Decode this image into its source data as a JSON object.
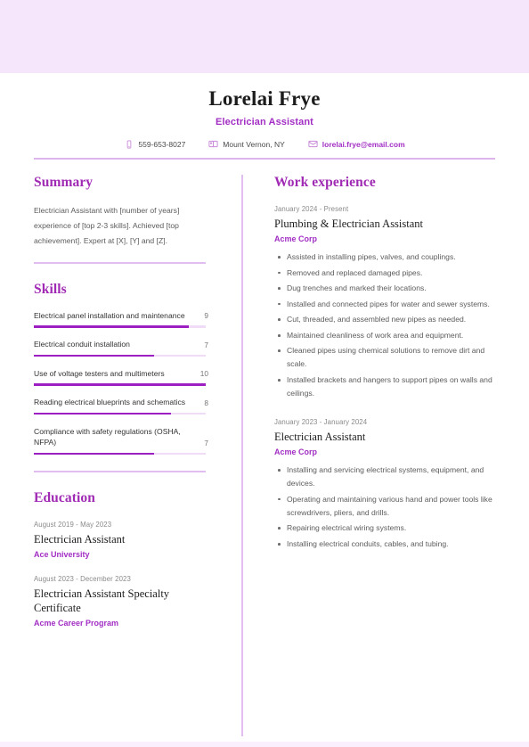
{
  "theme": {
    "accent": "#a22ec4",
    "accent_bar": "#9b1fc1",
    "band": "#f6e6fb",
    "rule": "#e2bdf0"
  },
  "header": {
    "name": "Lorelai Frye",
    "job_title": "Electrician Assistant",
    "contacts": [
      {
        "icon": "phone-icon",
        "text": "559-653-8027"
      },
      {
        "icon": "location-icon",
        "text": "Mount Vernon, NY"
      },
      {
        "icon": "email-icon",
        "text": "lorelai.frye@email.com"
      }
    ]
  },
  "left": {
    "summary": {
      "title": "Summary",
      "text": "Electrician Assistant with [number of years] experience of [top 2-3 skills]. Achieved [top achievement]. Expert at [X], [Y] and [Z]."
    },
    "skills": {
      "title": "Skills",
      "max": 10,
      "items": [
        {
          "name": "Electrical panel installation and maintenance",
          "score": "9",
          "value": 9
        },
        {
          "name": "Electrical conduit installation",
          "score": "7",
          "value": 7
        },
        {
          "name": "Use of voltage testers and multimeters",
          "score": "10",
          "value": 10
        },
        {
          "name": "Reading electrical blueprints and schematics",
          "score": "8",
          "value": 8
        },
        {
          "name": "Compliance with safety regulations (OSHA, NFPA)",
          "score": "7",
          "value": 7
        }
      ]
    },
    "education": {
      "title": "Education",
      "items": [
        {
          "date": "August 2019 - May 2023",
          "degree": "Electrician Assistant",
          "school": "Ace University"
        },
        {
          "date": "August 2023 - December 2023",
          "degree": "Electrician Assistant Specialty Certificate",
          "school": "Acme Career Program"
        }
      ]
    }
  },
  "right": {
    "work": {
      "title": "Work experience",
      "items": [
        {
          "date": "January 2024 - Present",
          "role": "Plumbing & Electrician Assistant",
          "company": "Acme Corp",
          "bullets": [
            "Assisted in installing pipes, valves, and couplings.",
            "Removed and replaced damaged pipes.",
            "Dug trenches and marked their locations.",
            "Installed and connected pipes for water and sewer systems.",
            "Cut, threaded, and assembled new pipes as needed.",
            "Maintained cleanliness of work area and equipment.",
            "Cleaned pipes using chemical solutions to remove dirt and scale.",
            "Installed brackets and hangers to support pipes on walls and ceilings."
          ]
        },
        {
          "date": "January 2023 - January 2024",
          "role": "Electrician Assistant",
          "company": "Acme Corp",
          "bullets": [
            "Installing and servicing electrical systems, equipment, and devices.",
            "Operating and maintaining various hand and power tools like screwdrivers, pliers, and drills.",
            "Repairing electrical wiring systems.",
            "Installing electrical conduits, cables, and tubing."
          ]
        }
      ]
    }
  }
}
